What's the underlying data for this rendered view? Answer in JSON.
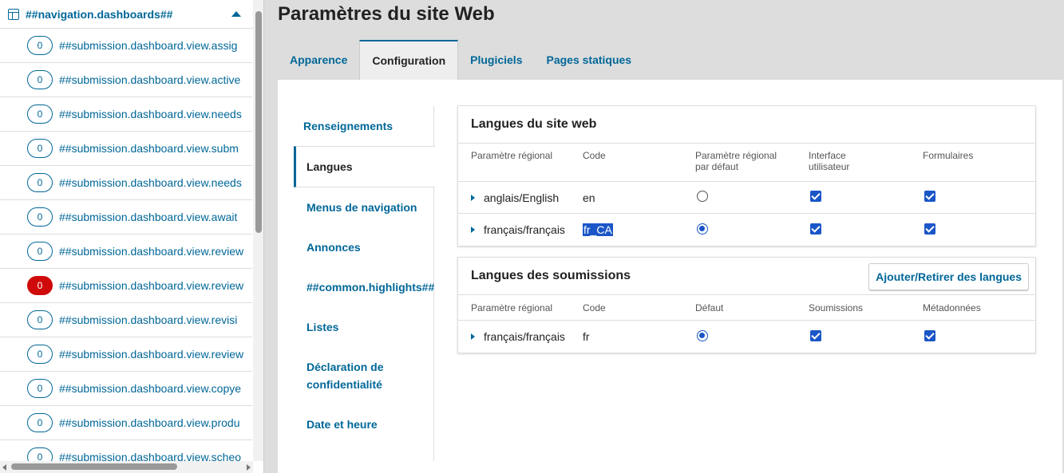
{
  "sidebar": {
    "title": "##navigation.dashboards##",
    "items": [
      {
        "count": "0",
        "label": "##submission.dashboard.view.assig",
        "alert": false
      },
      {
        "count": "0",
        "label": "##submission.dashboard.view.active",
        "alert": false
      },
      {
        "count": "0",
        "label": "##submission.dashboard.view.needs",
        "alert": false
      },
      {
        "count": "0",
        "label": "##submission.dashboard.view.subm",
        "alert": false
      },
      {
        "count": "0",
        "label": "##submission.dashboard.view.needs",
        "alert": false
      },
      {
        "count": "0",
        "label": "##submission.dashboard.view.await",
        "alert": false
      },
      {
        "count": "0",
        "label": "##submission.dashboard.view.review",
        "alert": false
      },
      {
        "count": "0",
        "label": "##submission.dashboard.view.review",
        "alert": true
      },
      {
        "count": "0",
        "label": "##submission.dashboard.view.revisi",
        "alert": false
      },
      {
        "count": "0",
        "label": "##submission.dashboard.view.review",
        "alert": false
      },
      {
        "count": "0",
        "label": "##submission.dashboard.view.copye",
        "alert": false
      },
      {
        "count": "0",
        "label": "##submission.dashboard.view.produ",
        "alert": false
      },
      {
        "count": "0",
        "label": "##submission.dashboard.view.scheo",
        "alert": false
      }
    ]
  },
  "main": {
    "title": "Paramètres du site Web",
    "tabs": [
      "Apparence",
      "Configuration",
      "Plugiciels",
      "Pages statiques"
    ],
    "subnav": {
      "first": "Renseignements",
      "active": "Langues",
      "menus": "Menus de navigation",
      "announcements": "Annonces",
      "highlights": "##common.highlights##",
      "lists": "Listes",
      "privacy": "Déclaration de confidentialité",
      "datetime": "Date et heure"
    },
    "site_languages": {
      "title": "Langues du site web",
      "headers": [
        "Paramètre régional",
        "Code",
        "Paramètre régional par défaut",
        "Interface utilisateur",
        "Formulaires"
      ],
      "rows": [
        {
          "locale": "anglais/English",
          "code": "en",
          "default": false,
          "ui": true,
          "forms": true
        },
        {
          "locale": "français/français",
          "code": "fr_CA",
          "default": true,
          "ui": true,
          "forms": true
        }
      ]
    },
    "submission_languages": {
      "title": "Langues des soumissions",
      "button": "Ajouter/Retirer des langues",
      "headers": [
        "Paramètre régional",
        "Code",
        "Défaut",
        "Soumissions",
        "Métadonnées"
      ],
      "rows": [
        {
          "locale": "français/français",
          "code": "fr",
          "default": true,
          "submissions": true,
          "metadata": true
        }
      ]
    }
  }
}
